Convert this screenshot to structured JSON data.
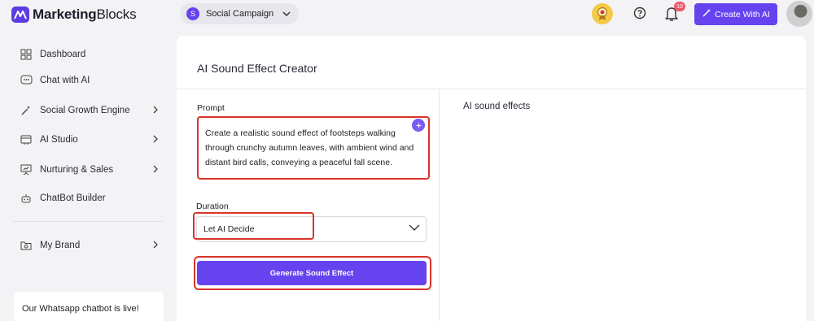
{
  "brand": {
    "name_bold": "Marketing",
    "name_rest": "Blocks"
  },
  "workspace": {
    "initial": "S",
    "name": "Social Campaign"
  },
  "header": {
    "notification_count": "10",
    "create_label": "Create With AI"
  },
  "sidebar": {
    "items": [
      {
        "label": "Dashboard",
        "icon": "grid-icon"
      },
      {
        "label": "Chat with AI",
        "icon": "chat-icon"
      },
      {
        "label": "Social Growth Engine",
        "icon": "magic-wand-icon"
      },
      {
        "label": "AI Studio",
        "icon": "studio-icon"
      },
      {
        "label": "Nurturing & Sales",
        "icon": "presentation-icon"
      },
      {
        "label": "ChatBot Builder",
        "icon": "robot-icon"
      },
      {
        "label": "My Brand",
        "icon": "brand-folder-icon"
      }
    ],
    "promo": "Our Whatsapp chatbot is live!"
  },
  "main": {
    "title": "AI Sound Effect Creator",
    "prompt_label": "Prompt",
    "prompt_value": "Create a realistic sound effect of footsteps walking through crunchy autumn leaves, with ambient wind and distant bird calls, conveying a peaceful fall scene.",
    "duration_label": "Duration",
    "duration_value": "Let AI Decide",
    "generate_label": "Generate Sound Effect",
    "results_title": "AI sound effects"
  },
  "colors": {
    "accent": "#6543ef",
    "highlight": "#d9342b",
    "badge": "#ef5a6a"
  }
}
